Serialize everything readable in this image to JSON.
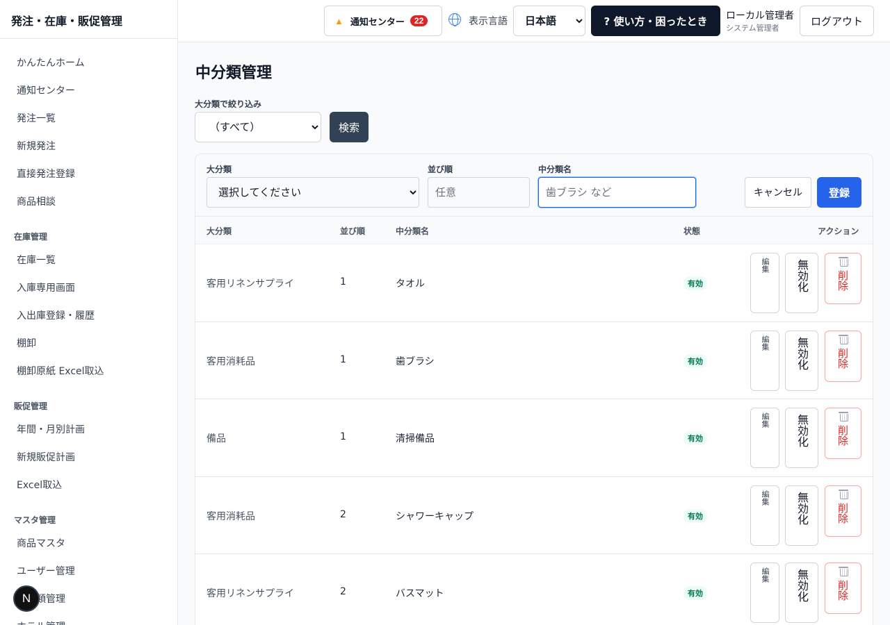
{
  "app": {
    "title": "発注・在庫・販促管理"
  },
  "sidebar": {
    "items_top": [
      {
        "label": "かんたんホーム"
      },
      {
        "label": "通知センター"
      },
      {
        "label": "発注一覧"
      },
      {
        "label": "新規発注"
      },
      {
        "label": "直接発注登録"
      },
      {
        "label": "商品相談"
      }
    ],
    "section_inventory": "在庫管理",
    "items_inventory": [
      {
        "label": "在庫一覧"
      },
      {
        "label": "入庫専用画面"
      },
      {
        "label": "入出庫登録・履歴"
      },
      {
        "label": "棚卸"
      },
      {
        "label": "棚卸原紙 Excel取込"
      }
    ],
    "section_promo": "販促管理",
    "items_promo": [
      {
        "label": "年間・月別計画"
      },
      {
        "label": "新規販促計画"
      },
      {
        "label": "Excel取込"
      }
    ],
    "section_master": "マスタ管理",
    "items_master": [
      {
        "label": "商品マスタ"
      },
      {
        "label": "ユーザー管理"
      },
      {
        "label": "中分類管理"
      },
      {
        "label": "ホテル管理"
      }
    ],
    "fab_label": "N"
  },
  "header": {
    "notification_label": "通知センター",
    "notification_count": "22",
    "language_label": "表示言語",
    "language_value": "日本語",
    "help_label": "? 使い方・困ったとき",
    "user_name": "ローカル管理者",
    "user_role": "システム管理者",
    "logout_label": "ログアウト"
  },
  "page": {
    "title": "中分類管理",
    "filter_label": "大分類で絞り込み",
    "filter_value": "（すべて）",
    "search_label": "検索"
  },
  "form": {
    "major_label": "大分類",
    "major_placeholder": "選択してください",
    "order_label": "並び順",
    "order_placeholder": "任意",
    "name_label": "中分類名",
    "name_placeholder": "歯ブラシ など",
    "cancel_label": "キャンセル",
    "register_label": "登録"
  },
  "table": {
    "headers": {
      "major": "大分類",
      "order": "並び順",
      "name": "中分類名",
      "status": "状態",
      "action": "アクション"
    },
    "rows": [
      {
        "major": "客用リネンサプライ",
        "order": "1",
        "name": "タオル",
        "status": "有効"
      },
      {
        "major": "客用消耗品",
        "order": "1",
        "name": "歯ブラシ",
        "status": "有効"
      },
      {
        "major": "備品",
        "order": "1",
        "name": "清掃備品",
        "status": "有効"
      },
      {
        "major": "客用消耗品",
        "order": "2",
        "name": "シャワーキャップ",
        "status": "有効"
      },
      {
        "major": "客用リネンサプライ",
        "order": "2",
        "name": "バスマット",
        "status": "有効"
      }
    ],
    "edit_label": "編集",
    "disable_label": "無効化",
    "delete_label": "削除"
  },
  "colors": {
    "primary": "#2563eb",
    "dark": "#0f172a",
    "danger": "#dc2626",
    "success": "#047857"
  }
}
